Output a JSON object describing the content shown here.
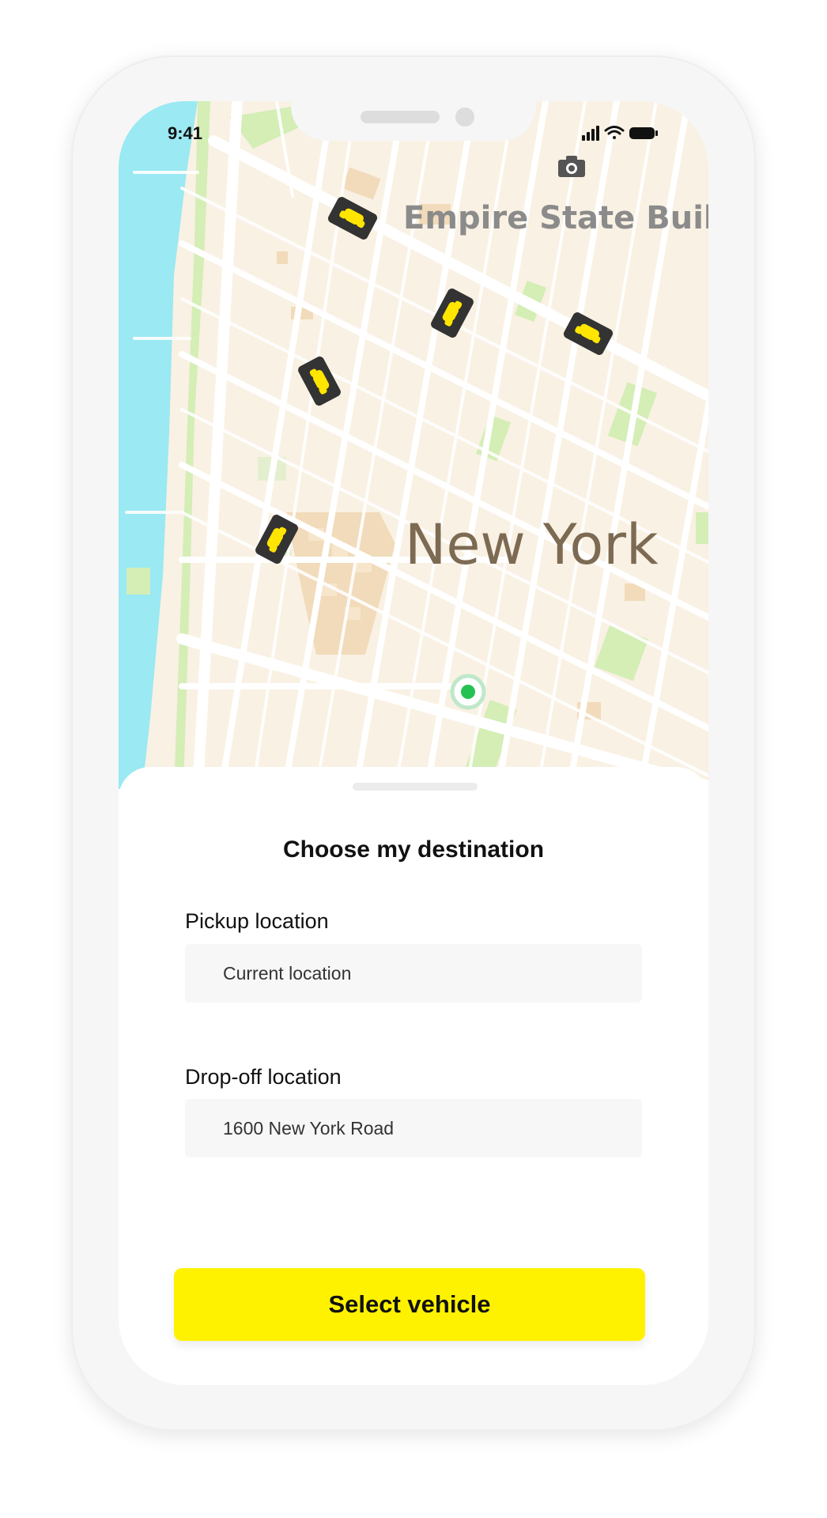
{
  "status_bar": {
    "time": "9:41"
  },
  "map": {
    "city_label": "New York",
    "poi_label": "Empire State Buildi",
    "colors": {
      "land": "#f9f1e3",
      "water": "#9ae9f3",
      "park": "#d4eeb6",
      "road": "#ffffff",
      "building": "#f1dbba"
    },
    "poi_icon": "camera-icon",
    "vehicle_icon": "taxi-icon",
    "vehicle_count": 5,
    "current_location_icon": "current-location-dot"
  },
  "sheet": {
    "title": "Choose my destination",
    "pickup": {
      "label": "Pickup location",
      "value": "Current location"
    },
    "dropoff": {
      "label": "Drop-off location",
      "value": "1600 New York Road"
    },
    "cta_label": "Select vehicle",
    "accent_color": "#fff200"
  }
}
